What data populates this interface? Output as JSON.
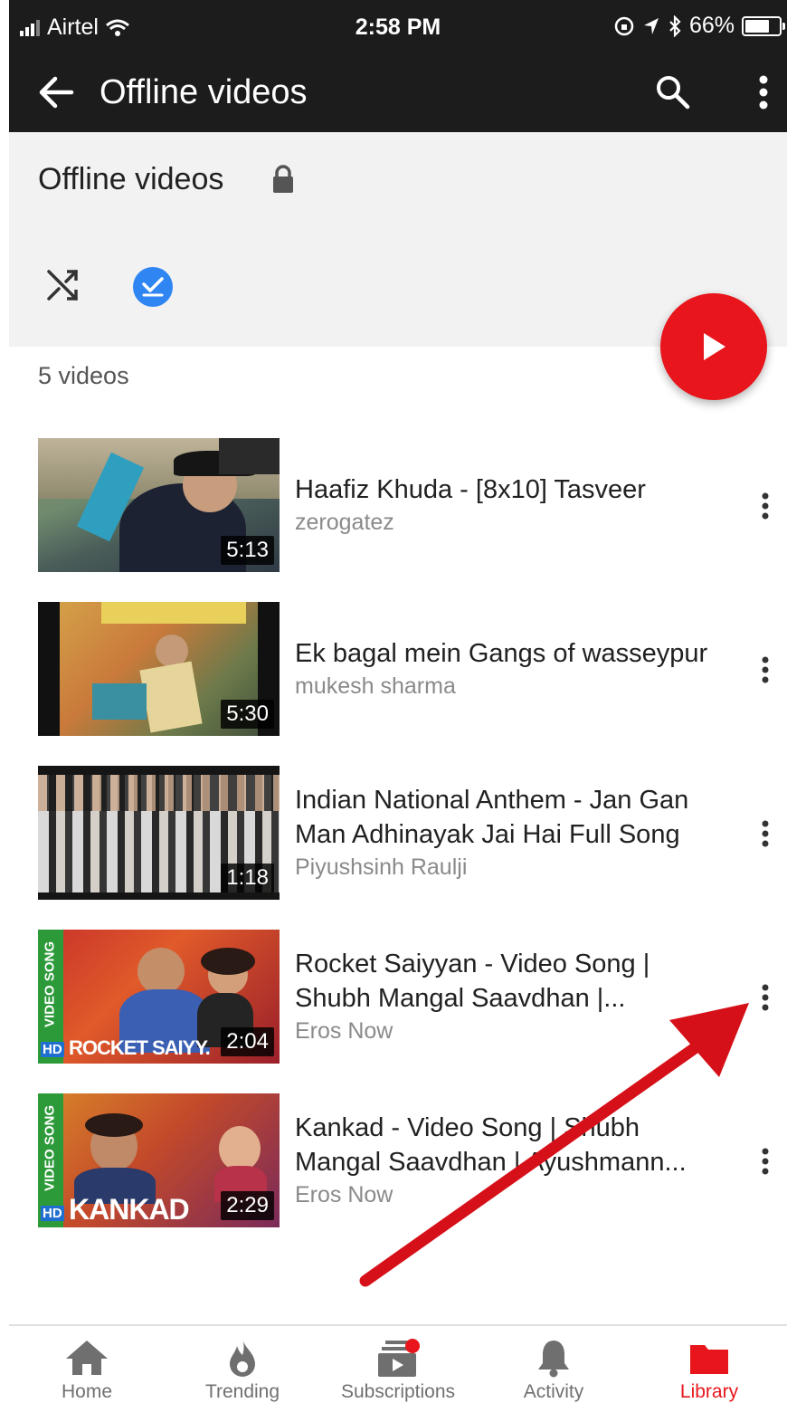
{
  "status_bar": {
    "carrier": "Airtel",
    "time": "2:58 PM",
    "battery": "66%"
  },
  "app_bar": {
    "title": "Offline videos",
    "back_icon": "arrow-left-icon",
    "search_icon": "search-icon",
    "more_icon": "more-vert-icon"
  },
  "playlist": {
    "title": "Offline videos",
    "lock_icon": "lock-icon",
    "shuffle_icon": "shuffle-icon",
    "check_icon": "check-icon",
    "count": "5 videos",
    "play_icon": "play-icon"
  },
  "videos": [
    {
      "title": "Haafiz Khuda - [8x10] Tasveer",
      "channel": "zerogatez",
      "duration": "5:13"
    },
    {
      "title": "Ek bagal mein Gangs of wasseypur",
      "channel": "mukesh sharma",
      "duration": "5:30"
    },
    {
      "title": "Indian National Anthem - Jan Gan Man Adhinayak Jai Hai Full Song",
      "channel": "Piyushsinh Raulji",
      "duration": "1:18"
    },
    {
      "title": "Rocket Saiyyan - Video Song | Shubh Mangal Saavdhan |...",
      "channel": "Eros Now",
      "duration": "2:04",
      "overlay": "ROCKET SAIYY.",
      "badge": "VIDEO SONG",
      "hd": "HD"
    },
    {
      "title": "Kankad - Video Song | Shubh Mangal Saavdhan | Ayushmann...",
      "channel": "Eros Now",
      "duration": "2:29",
      "overlay": "KANKAD",
      "badge": "VIDEO SONG",
      "hd": "HD"
    }
  ],
  "bottom_nav": [
    {
      "label": "Home",
      "icon": "home-icon",
      "active": false
    },
    {
      "label": "Trending",
      "icon": "flame-icon",
      "active": false
    },
    {
      "label": "Subscriptions",
      "icon": "subscriptions-icon",
      "active": false
    },
    {
      "label": "Activity",
      "icon": "bell-icon",
      "active": false
    },
    {
      "label": "Library",
      "icon": "folder-icon",
      "active": true
    }
  ],
  "colors": {
    "brand_red": "#e8161c",
    "check_blue": "#2f86f2",
    "app_bar": "#1c1c1c",
    "header_bg": "#f2f2f2"
  }
}
